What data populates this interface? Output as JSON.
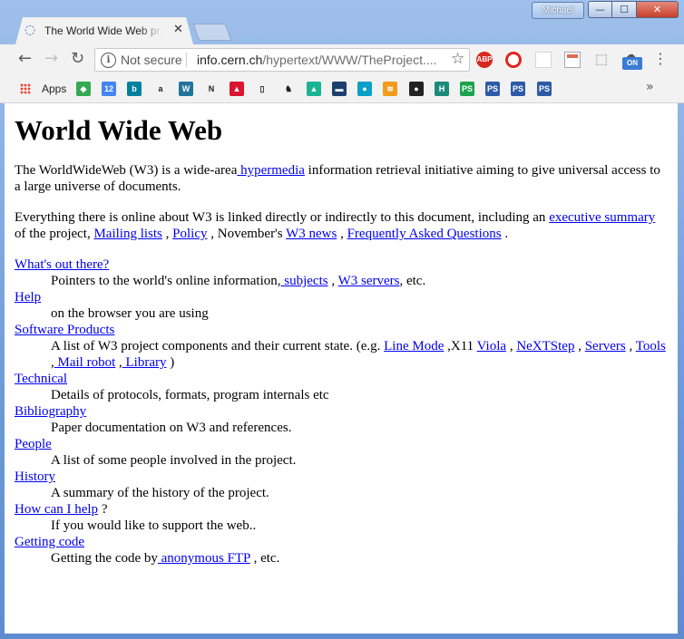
{
  "window": {
    "user": "Michael",
    "minimize": "—",
    "maximize": "☐",
    "close": "✕"
  },
  "tab": {
    "title": "The World Wide Web project",
    "close_icon": "✕",
    "favicon": "globe-icon"
  },
  "toolbar": {
    "back": "←",
    "forward": "→",
    "reload": "↻",
    "not_secure": "Not secure",
    "url_host": "info.cern.ch",
    "url_path": "/hypertext/WWW/TheProject....",
    "star": "☆",
    "abp": "ABP",
    "on_label": "ON",
    "menu": "⋮"
  },
  "bookmarks": {
    "apps_label": "Apps",
    "more": "»",
    "items": [
      {
        "name": "maps",
        "color": "#34a853",
        "glyph": "◆"
      },
      {
        "name": "calendar",
        "color": "#4285f4",
        "glyph": "12"
      },
      {
        "name": "bing",
        "color": "#00809d",
        "glyph": "b"
      },
      {
        "name": "amazon",
        "color": "#ffffff",
        "glyph": "a"
      },
      {
        "name": "wordpress",
        "color": "#21759b",
        "glyph": "W"
      },
      {
        "name": "nyt",
        "color": "#ffffff",
        "glyph": "N"
      },
      {
        "name": "bofa",
        "color": "#dc1431",
        "glyph": "▲"
      },
      {
        "name": "doc",
        "color": "#ffffff",
        "glyph": "▯"
      },
      {
        "name": "horse",
        "color": "#ffffff",
        "glyph": "♞"
      },
      {
        "name": "mountain",
        "color": "#1ab394",
        "glyph": "▲"
      },
      {
        "name": "box",
        "color": "#1c3f6e",
        "glyph": "▬"
      },
      {
        "name": "pin",
        "color": "#0aa0c8",
        "glyph": "●"
      },
      {
        "name": "layers",
        "color": "#f29b1d",
        "glyph": "≋"
      },
      {
        "name": "github",
        "color": "#222222",
        "glyph": "●"
      },
      {
        "name": "h",
        "color": "#1b8a7a",
        "glyph": "H"
      },
      {
        "name": "ps1",
        "color": "#1ba34e",
        "glyph": "PS"
      },
      {
        "name": "ps2",
        "color": "#2e5aa8",
        "glyph": "PS"
      },
      {
        "name": "ps3",
        "color": "#2e5aa8",
        "glyph": "PS"
      },
      {
        "name": "ps4",
        "color": "#2e5aa8",
        "glyph": "PS"
      }
    ]
  },
  "page": {
    "title": "World Wide Web",
    "intro_before": "The WorldWideWeb (W3) is a wide-area",
    "intro_link": " hypermedia",
    "intro_after": " information retrieval initiative aiming to give universal access to a large universe of documents.",
    "p2_before": "Everything there is online about W3 is linked directly or indirectly to this document, including an ",
    "p2_link_summary": "executive summary",
    "p2_mid1": " of the project, ",
    "p2_link_mailing": "Mailing lists",
    "p2_mid2": " , ",
    "p2_link_policy": "Policy",
    "p2_mid3": " , November's ",
    "p2_link_news": "W3 news",
    "p2_mid4": " , ",
    "p2_link_faq": "Frequently Asked Questions",
    "p2_end": " .",
    "list": {
      "whats_out": "What's out there?",
      "whats_out_desc_before": "Pointers to the world's online information,",
      "whats_out_link_subjects": " subjects",
      "whats_out_mid": " , ",
      "whats_out_link_servers": "W3 servers",
      "whats_out_end": ", etc.",
      "help": "Help",
      "help_desc": "on the browser you are using",
      "software": "Software Products",
      "software_desc_before": "A list of W3 project components and their current state. (e.g. ",
      "software_link_linemode": "Line Mode",
      "software_mid1": " ,X11 ",
      "software_link_viola": "Viola",
      "software_mid2": " , ",
      "software_link_nextstep": "NeXTStep",
      "software_mid3": " , ",
      "software_link_servers": "Servers",
      "software_mid4": " , ",
      "software_link_tools": "Tools",
      "software_mid5": " ,",
      "software_link_mailrobot": " Mail robot",
      "software_mid6": " ,",
      "software_link_library": " Library",
      "software_end": " )",
      "technical": "Technical",
      "technical_desc": "Details of protocols, formats, program internals etc",
      "bibliography": "Bibliography",
      "bibliography_desc": "Paper documentation on W3 and references.",
      "people": "People",
      "people_desc": "A list of some people involved in the project.",
      "history": "History",
      "history_desc": "A summary of the history of the project.",
      "howcan": "How can I help",
      "howcan_after": " ?",
      "howcan_desc": "If you would like to support the web..",
      "getting": "Getting code",
      "getting_desc_before": "Getting the code by",
      "getting_link_ftp": " anonymous FTP",
      "getting_end": " , etc."
    }
  }
}
